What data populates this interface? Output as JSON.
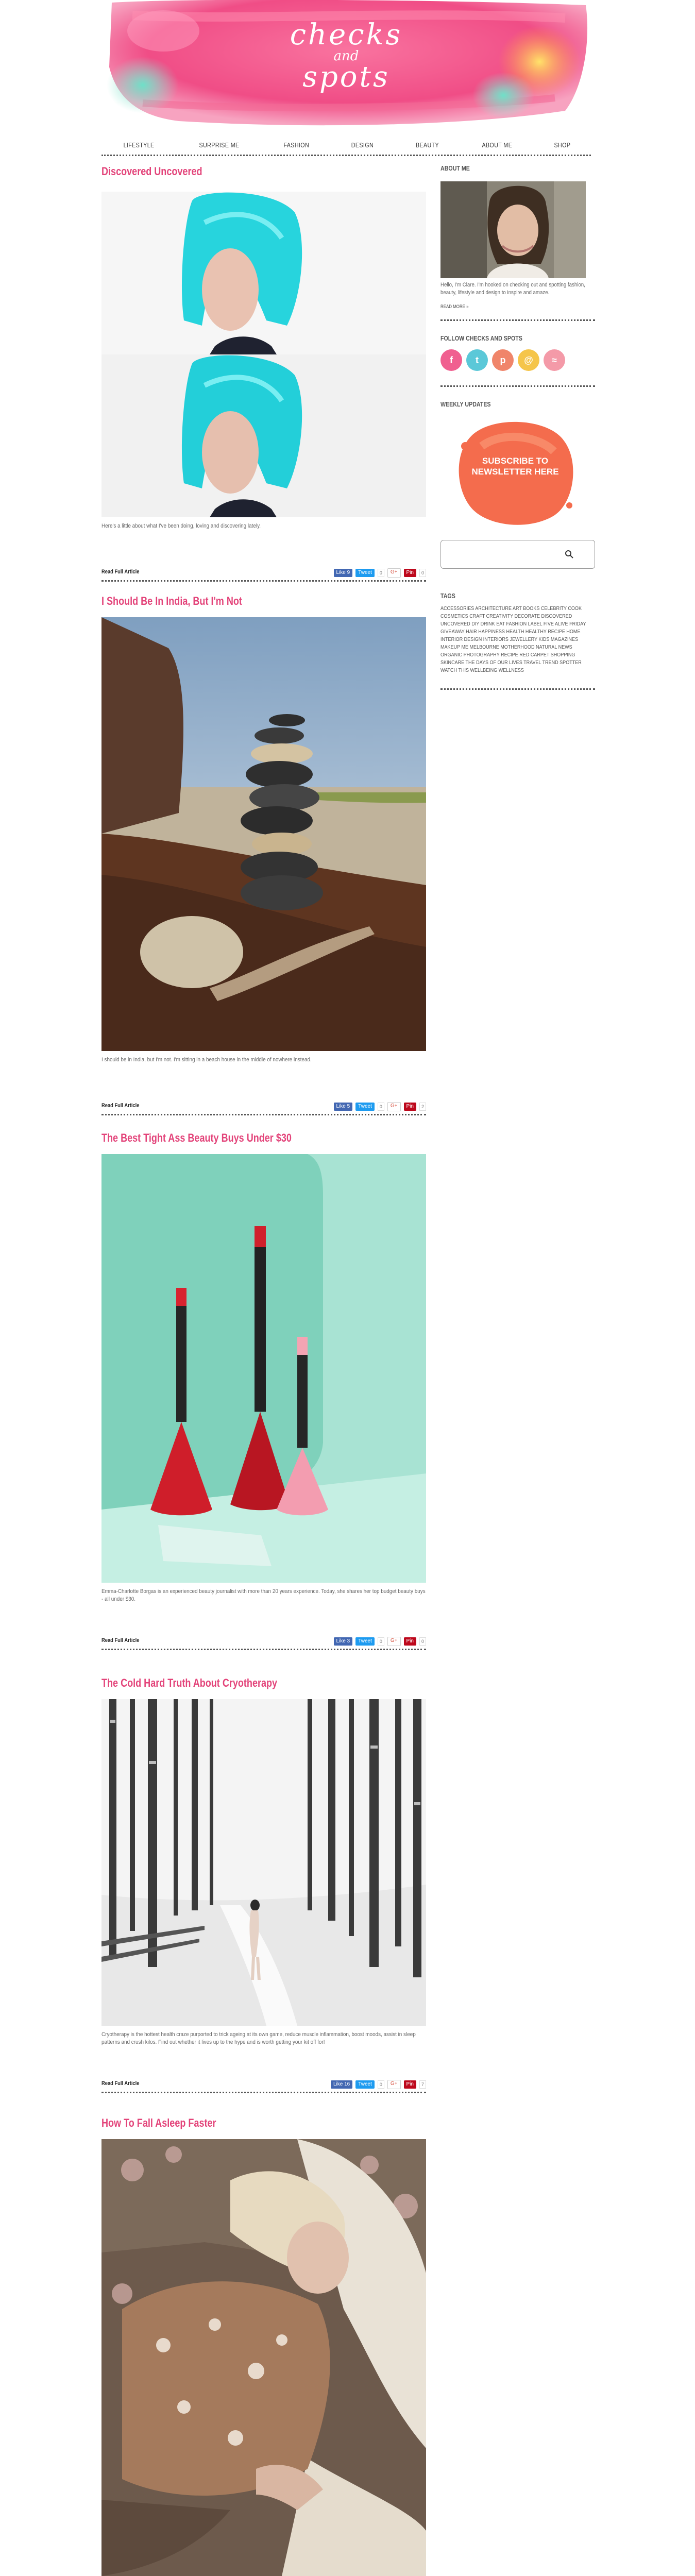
{
  "site": {
    "logo_line1": "checks",
    "logo_line2": "and",
    "logo_line3": "spots"
  },
  "nav": [
    {
      "label": "LIFESTYLE"
    },
    {
      "label": "SURPRISE ME"
    },
    {
      "label": "FASHION"
    },
    {
      "label": "DESIGN"
    },
    {
      "label": "BEAUTY"
    },
    {
      "label": "ABOUT ME"
    },
    {
      "label": "SHOP"
    }
  ],
  "posts": [
    {
      "title": "Discovered Uncovered",
      "excerpt": "Here's a little about what I've been doing, loving and discovering lately.",
      "read_more": "Read Full Article",
      "fb_label": "Like 9",
      "tw_label": "Tweet",
      "tw_count": "0",
      "g_label": "G+",
      "pin_label": "Pin",
      "pin_count": "0"
    },
    {
      "title": "I Should Be In India, But I'm Not",
      "excerpt": "I should be in India, but I'm not. I'm sitting in a beach house in the middle of nowhere instead.",
      "read_more": "Read Full Article",
      "fb_label": "Like 5",
      "tw_label": "Tweet",
      "tw_count": "0",
      "g_label": "G+",
      "pin_label": "Pin",
      "pin_count": "2"
    },
    {
      "title": "The Best Tight Ass Beauty Buys Under $30",
      "excerpt": "Emma-Charlotte Borgas is an experienced beauty journalist with more than 20 years experience. Today, she shares her top budget beauty buys - all under $30.",
      "read_more": "Read Full Article",
      "fb_label": "Like 3",
      "tw_label": "Tweet",
      "tw_count": "0",
      "g_label": "G+",
      "pin_label": "Pin",
      "pin_count": "0"
    },
    {
      "title": "The Cold Hard Truth About Cryotherapy",
      "excerpt": "Cryotherapy is the hottest health craze purported to trick ageing at its own game, reduce muscle inflammation, boost moods, assist in sleep patterns and crush kilos. Find out whether it lives up to the hype and is worth getting your kit off for!",
      "read_more": "Read Full Article",
      "fb_label": "Like 16",
      "tw_label": "Tweet",
      "tw_count": "0",
      "g_label": "G+",
      "pin_label": "Pin",
      "pin_count": "7"
    },
    {
      "title": "How To Fall Asleep Faster",
      "excerpt": "",
      "read_more": "",
      "fb_label": "",
      "tw_label": "",
      "tw_count": "",
      "g_label": "",
      "pin_label": "",
      "pin_count": ""
    }
  ],
  "sidebar": {
    "about_heading": "ABOUT ME",
    "about_text": "Hello, I'm Clare. I'm hooked on checking out and spotting fashion, beauty, lifestyle and design to inspire and amaze.",
    "about_more": "READ MORE »",
    "follow_heading": "FOLLOW CHECKS AND SPOTS",
    "social": [
      {
        "icon": "facebook-icon",
        "glyph": "f",
        "color": "#f06090"
      },
      {
        "icon": "twitter-icon",
        "glyph": "t",
        "color": "#5bc8d8"
      },
      {
        "icon": "pinterest-icon",
        "glyph": "p",
        "color": "#f0856a"
      },
      {
        "icon": "email-icon",
        "glyph": "@",
        "color": "#f5c54a"
      },
      {
        "icon": "rss-icon",
        "glyph": "≈",
        "color": "#f49aa8"
      }
    ],
    "weekly_heading": "WEEKLY UPDATES",
    "subscribe_line1": "SUBSCRIBE TO",
    "subscribe_line2": "NEWSLETTER HERE",
    "tags_heading": "TAGS",
    "tags_text": "ACCESSORIES ARCHITECTURE ART BOOKS CELEBRITY COOK COSMETICS CRAFT CREATIVITY DECORATE DISCOVERED UNCOVERED DIY DRINK EAT FASHION LABEL FIVE ALIVE FRIDAY GIVEAWAY HAIR HAPPINESS HEALTH HEALTHY RECIPE HOME INTERIOR DESIGN INTERIORS JEWELLERY KIDS MAGAZINES MAKEUP ME MELBOURNE MOTHERHOOD NATURAL NEWS ORGANIC PHOTOGRAPHY RECIPE RED CARPET SHOPPING SKINCARE THE DAYS OF OUR LIVES TRAVEL TREND SPOTTER WATCH THIS WELLBEING WELLNESS"
  }
}
